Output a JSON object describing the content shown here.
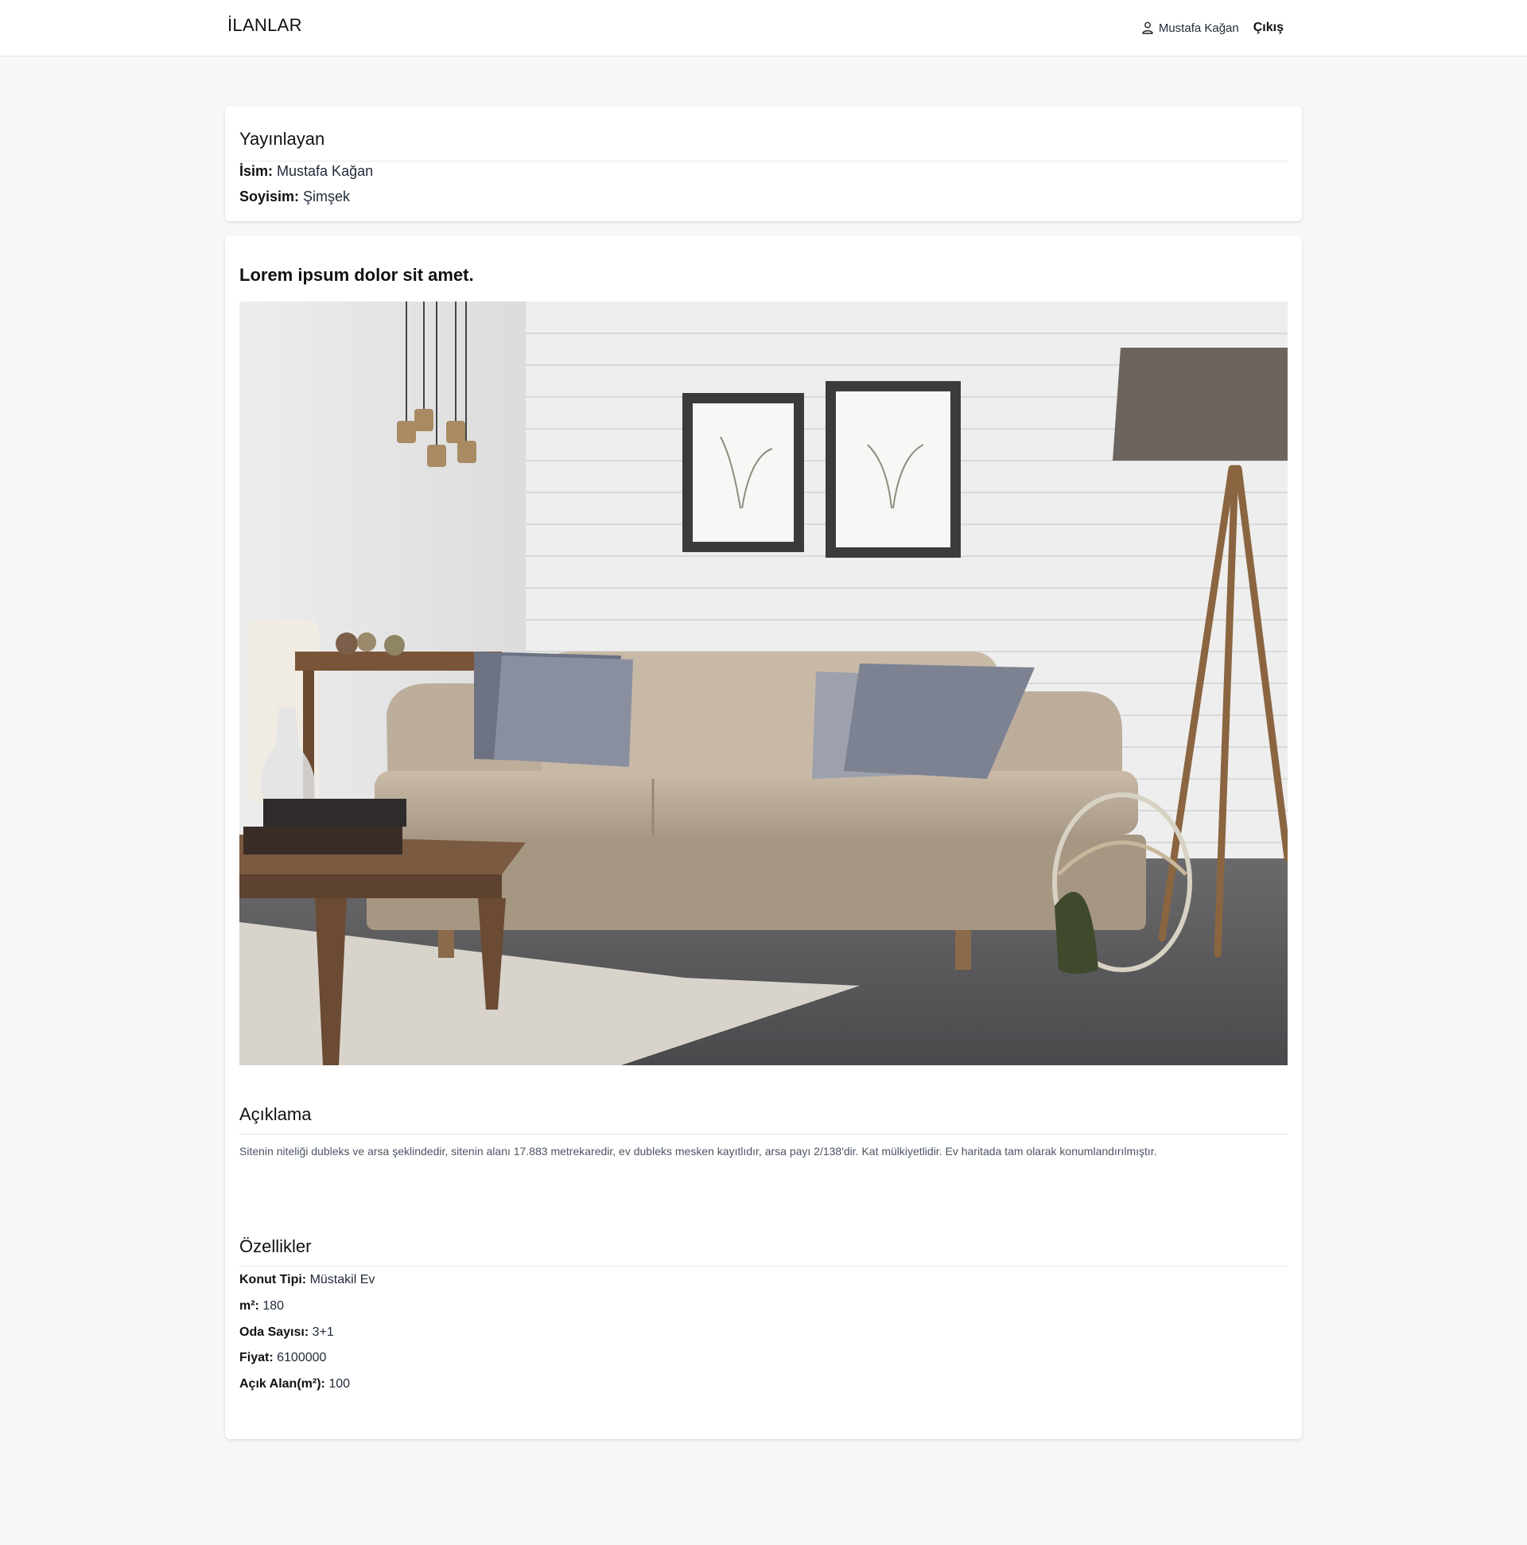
{
  "header": {
    "brand": "İLANLAR",
    "user_name": "Mustafa Kağan",
    "logout_label": "Çıkış"
  },
  "publisher": {
    "title": "Yayınlayan",
    "name_label": "İsim:",
    "name_value": "Mustafa Kağan",
    "surname_label": "Soyisim:",
    "surname_value": "Şimşek"
  },
  "listing": {
    "title": "Lorem ipsum dolor sit amet.",
    "photo_subject": "living-room-sofa-photo",
    "description_title": "Açıklama",
    "description_text": "Sitenin niteliği dubleks ve arsa şeklindedir, sitenin alanı 17.883 metrekaredir, ev dubleks mesken kayıtlıdır, arsa payı 2/138'dir. Kat mülkiyetlidir. Ev haritada tam olarak konumlandırılmıştır.",
    "features_title": "Özellikler",
    "features": [
      {
        "label": "Konut Tipi:",
        "value": "Müstakil Ev"
      },
      {
        "label": "m²:",
        "value": "180"
      },
      {
        "label": "Oda Sayısı:",
        "value": "3+1"
      },
      {
        "label": "Fiyat:",
        "value": "6100000"
      },
      {
        "label": "Açık Alan(m²):",
        "value": "100"
      }
    ]
  },
  "colors": {
    "page_background": "#f6f7f9",
    "card_background": "#ffffff",
    "divider": "#e5e7eb",
    "muted_text": "#4b5563"
  },
  "icons": {
    "user": "user-icon"
  }
}
